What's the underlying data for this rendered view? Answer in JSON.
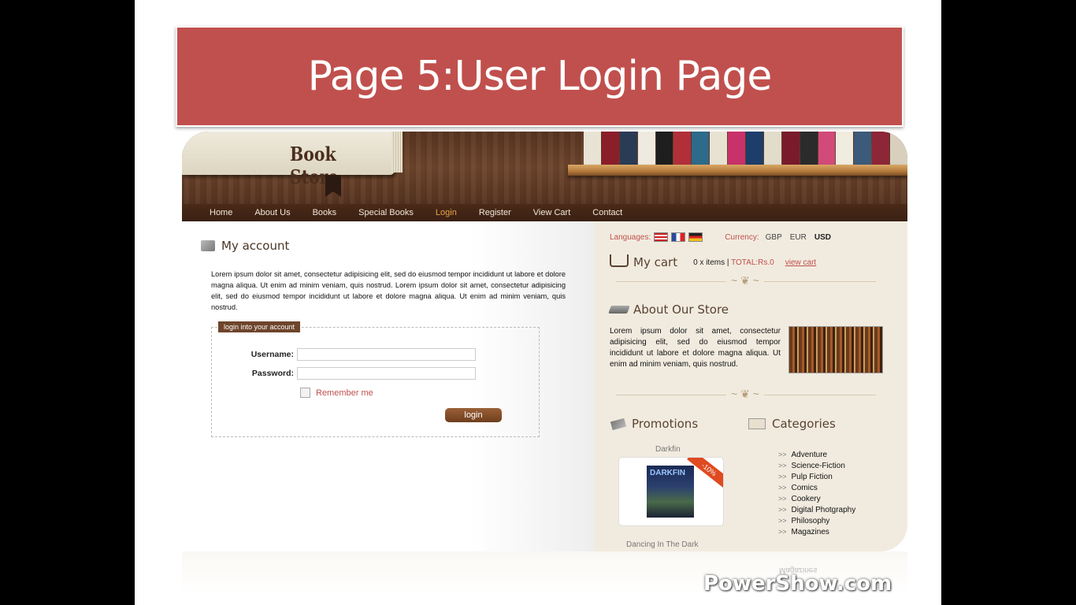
{
  "slide": {
    "title": "Page 5:User Login Page",
    "watermark": "PowerShow.com"
  },
  "site": {
    "logo": "Book Store",
    "nav": [
      "Home",
      "About Us",
      "Books",
      "Special Books",
      "Login",
      "Register",
      "View Cart",
      "Contact"
    ],
    "active_nav": "Login"
  },
  "account": {
    "title": "My account",
    "intro": "Lorem ipsum dolor sit amet, consectetur adipisicing elit, sed do eiusmod tempor incididunt ut labore et dolore magna aliqua. Ut enim ad minim veniam, quis nostrud. Lorem ipsum dolor sit amet, consectetur adipisicing elit, sed do eiusmod tempor incididunt ut labore et dolore magna aliqua. Ut enim ad minim veniam, quis nostrud.",
    "legend": "login into your account",
    "username_label": "Username:",
    "password_label": "Password:",
    "username_value": "",
    "password_value": "",
    "remember_label": "Remember me",
    "login_button": "login"
  },
  "sidebar": {
    "languages_label": "Languages:",
    "currency_label": "Currency:",
    "currencies": [
      "GBP",
      "EUR",
      "USD"
    ],
    "cart_title": "My cart",
    "cart_items": "0 x items |",
    "cart_total": "TOTAL:Rs.0",
    "view_cart": "view cart",
    "about_title": "About Our Store",
    "about_text": "Lorem ipsum dolor sit amet, consectetur adipisicing elit, sed do eiusmod tempor incididunt ut labore et dolore magna aliqua. Ut enim ad minim veniam, quis nostrud.",
    "promotions_title": "Promotions",
    "promo_book": "Darkfin",
    "promo_cover_text": "DARKFIN",
    "promo_discount": "-10%",
    "promo_book2": "Dancing In The Dark",
    "categories_title": "Categories",
    "categories": [
      "Adventure",
      "Science-Fiction",
      "Pulp Fiction",
      "Comics",
      "Cookery",
      "Digital Photgraphy",
      "Philosophy",
      "Magazines"
    ],
    "reflection_text": "Magazines"
  }
}
